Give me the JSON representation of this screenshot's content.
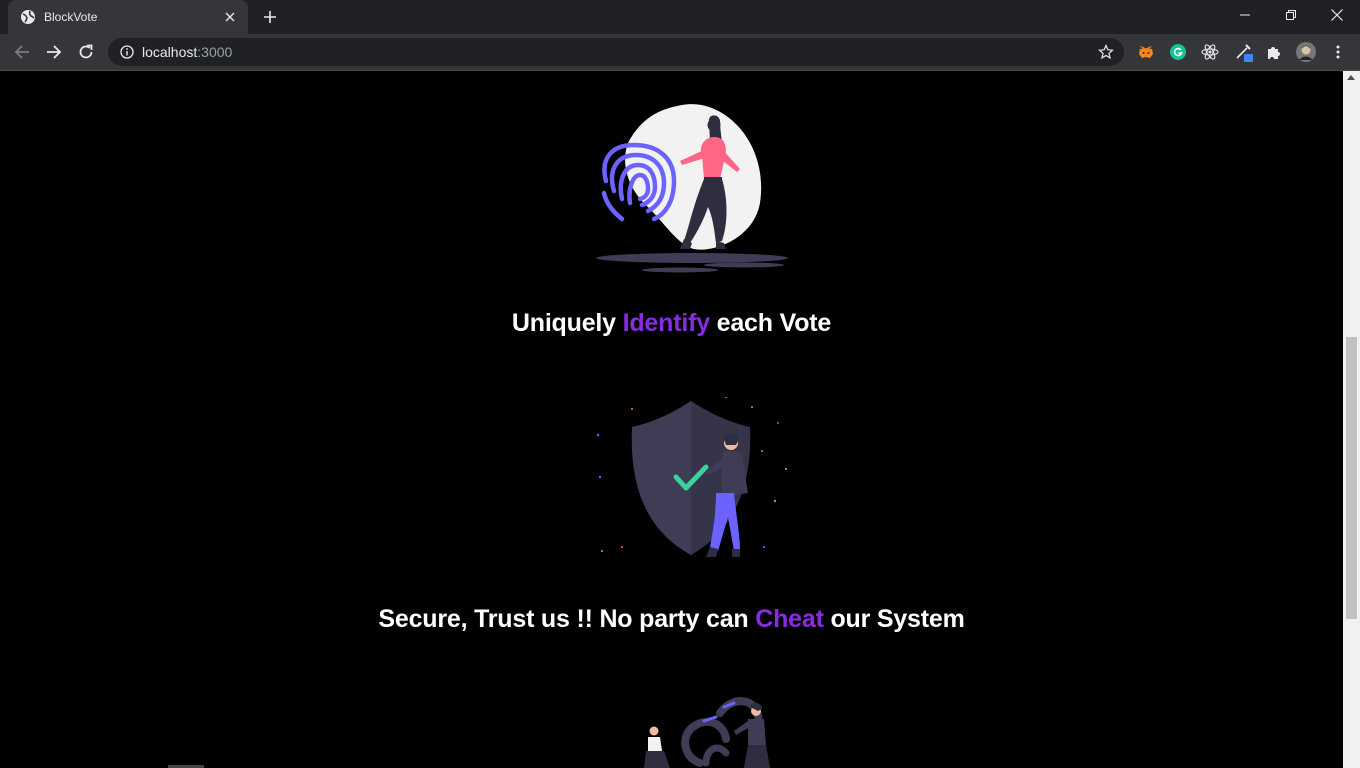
{
  "browser": {
    "tab_title": "BlockVote",
    "url_host": "localhost",
    "url_rest": ":3000"
  },
  "features": [
    {
      "before": "Uniquely ",
      "accent": "Identify",
      "after": " each Vote"
    },
    {
      "before": "Secure, Trust us !! No party can ",
      "accent": "Cheat",
      "after": " our System"
    }
  ],
  "colors": {
    "accent": "#8a2be2",
    "background": "#000000",
    "illustration_purple": "#6c63ff",
    "illustration_pink": "#ff6584",
    "check_green": "#3ad29f"
  },
  "icons": [
    "globe-favicon",
    "close-icon",
    "plus-icon",
    "back-icon",
    "forward-icon",
    "reload-icon",
    "info-icon",
    "star-icon",
    "metamask-icon",
    "grammarly-icon",
    "react-icon",
    "color-picker-icon",
    "extensions-icon",
    "avatar",
    "menu-icon"
  ]
}
